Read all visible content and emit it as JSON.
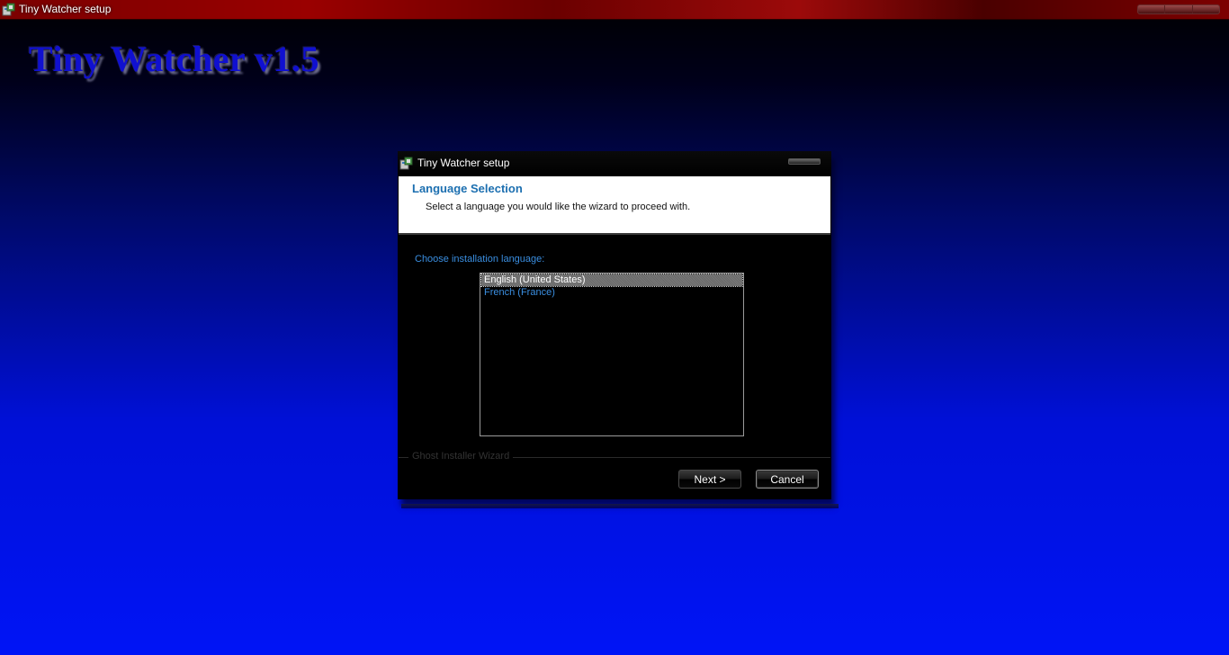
{
  "window": {
    "title": "Tiny Watcher setup",
    "icon": "installer-icon"
  },
  "banner": {
    "text": "Tiny Watcher v1.5"
  },
  "dialog": {
    "title": "Tiny Watcher setup",
    "header": {
      "title": "Language Selection",
      "subtitle": "Select a language you would like the wizard to proceed with."
    },
    "choose_label": "Choose installation language:",
    "languages": [
      {
        "label": "English (United States)",
        "selected": true
      },
      {
        "label": "French (France)",
        "selected": false
      }
    ],
    "group_label": "Ghost Installer Wizard",
    "buttons": {
      "next": "Next >",
      "cancel": "Cancel"
    }
  },
  "colors": {
    "title_bar": "#8a0000",
    "accent_text": "#3a8ee0",
    "header_title": "#1c6fb0",
    "banner": "#1010d0"
  }
}
